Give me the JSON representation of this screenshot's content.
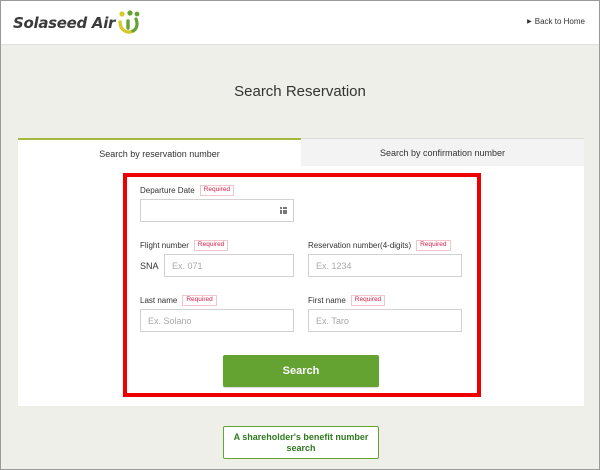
{
  "header": {
    "brand": "Solaseed Air",
    "back_link": "Back to Home",
    "colors": {
      "brand_green": "#64a231",
      "brand_yellow": "#d6c92a"
    }
  },
  "page": {
    "title": "Search Reservation"
  },
  "tabs": [
    {
      "label": "Search by reservation number",
      "active": true
    },
    {
      "label": "Search by confirmation number",
      "active": false
    }
  ],
  "form": {
    "required_label": "Required",
    "departure_date": {
      "label": "Departure Date",
      "value": "",
      "icon": "calendar-grid-icon"
    },
    "flight_number": {
      "label": "Flight number",
      "prefix": "SNA",
      "placeholder": "Ex. 071"
    },
    "reservation_number": {
      "label": "Reservation number(4-digits)",
      "placeholder": "Ex. 1234"
    },
    "last_name": {
      "label": "Last name",
      "placeholder": "Ex. Solano"
    },
    "first_name": {
      "label": "First name",
      "placeholder": "Ex. Taro"
    },
    "search_button": "Search"
  },
  "shareholder_button": "A shareholder's benefit number search",
  "colors": {
    "accent": "#64a231",
    "required": "#d6204a",
    "highlight": "#ee0000",
    "tab_active": "#a2b93c"
  }
}
